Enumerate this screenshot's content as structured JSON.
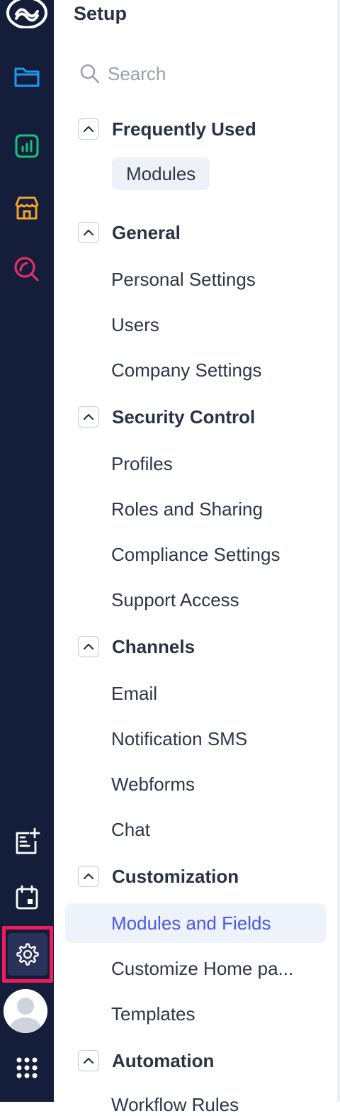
{
  "rail": {
    "icons": [
      "zoho-logo-icon",
      "folder-icon",
      "analytics-icon",
      "store-icon",
      "search-magnifier-icon",
      "add-note-icon",
      "calendar-icon",
      "gear-icon",
      "avatar-icon",
      "apps-grid-icon"
    ]
  },
  "setup": {
    "title": "Setup",
    "search_placeholder": "Search",
    "sections": [
      {
        "label": "Frequently Used",
        "items": [
          "Modules"
        ]
      },
      {
        "label": "General",
        "items": [
          "Personal Settings",
          "Users",
          "Company Settings"
        ]
      },
      {
        "label": "Security Control",
        "items": [
          "Profiles",
          "Roles and Sharing",
          "Compliance Settings",
          "Support Access"
        ]
      },
      {
        "label": "Channels",
        "items": [
          "Email",
          "Notification SMS",
          "Webforms",
          "Chat"
        ]
      },
      {
        "label": "Customization",
        "items": [
          "Modules and Fields",
          "Customize Home pa...",
          "Templates"
        ]
      },
      {
        "label": "Automation",
        "items": [
          "Workflow Rules"
        ]
      }
    ],
    "active_item": "Modules and Fields"
  },
  "colors": {
    "rail_bg": "#141d3a",
    "accent": "#4a5ae0",
    "highlight": "#ee1c5a",
    "folder": "#1a9bf0",
    "analytics": "#18c27f",
    "store": "#f0a32a",
    "search": "#e0306a"
  }
}
